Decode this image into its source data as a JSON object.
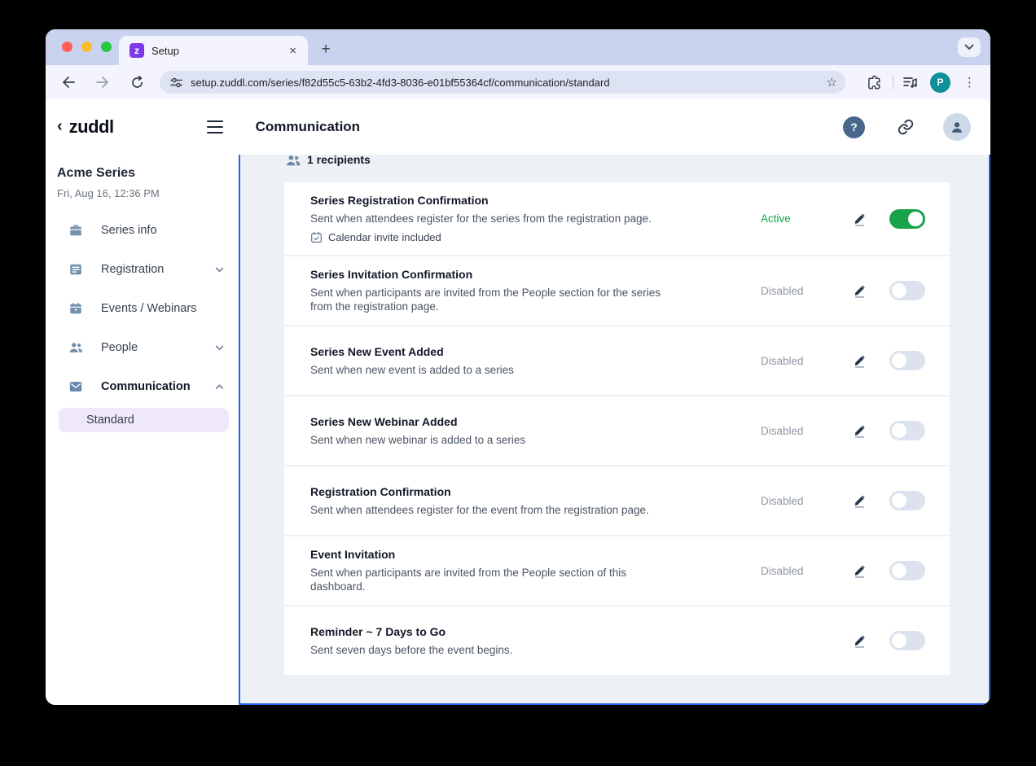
{
  "browser": {
    "tab_title": "Setup",
    "tab_favicon_letter": "z",
    "url": "setup.zuddl.com/series/f82d55c5-63b2-4fd3-8036-e01bf55364cf/communication/standard",
    "profile_initial": "P"
  },
  "app_header": {
    "back_chevron": "‹",
    "logo": "zuddl",
    "title": "Communication",
    "help_label": "?"
  },
  "sidebar": {
    "series_name": "Acme Series",
    "series_datetime": "Fri, Aug 16, 12:36 PM",
    "items": [
      {
        "label": "Series info",
        "icon": "briefcase-icon",
        "chevron": ""
      },
      {
        "label": "Registration",
        "icon": "form-icon",
        "chevron": "down"
      },
      {
        "label": "Events / Webinars",
        "icon": "calendar-icon",
        "chevron": ""
      },
      {
        "label": "People",
        "icon": "people-icon",
        "chevron": "down"
      },
      {
        "label": "Communication",
        "icon": "mail-icon",
        "chevron": "up"
      }
    ],
    "sub_item_label": "Standard"
  },
  "main": {
    "recipients_label": "1 recipients",
    "emails": [
      {
        "title": "Series Registration Confirmation",
        "description": "Sent when attendees register for the series from the registration page.",
        "badge": "Calendar invite included",
        "status": "Active",
        "enabled": true
      },
      {
        "title": "Series Invitation Confirmation",
        "description": "Sent when participants are invited from the People section for the series from the registration page.",
        "badge": "",
        "status": "Disabled",
        "enabled": false
      },
      {
        "title": "Series New Event Added",
        "description": "Sent when new event is added to a series",
        "badge": "",
        "status": "Disabled",
        "enabled": false
      },
      {
        "title": "Series New Webinar Added",
        "description": "Sent when new webinar is added to a series",
        "badge": "",
        "status": "Disabled",
        "enabled": false
      },
      {
        "title": "Registration Confirmation",
        "description": "Sent when attendees register for the event from the registration page.",
        "badge": "",
        "status": "Disabled",
        "enabled": false
      },
      {
        "title": "Event Invitation",
        "description": "Sent when participants are invited from the People section of this dashboard.",
        "badge": "",
        "status": "Disabled",
        "enabled": false
      },
      {
        "title": "Reminder ~ 7 Days to Go",
        "description": "Sent seven days before the event begins.",
        "badge": "",
        "status": "",
        "enabled": false
      }
    ]
  },
  "colors": {
    "brand_purple": "#7c3aed",
    "active_green": "#16a34a",
    "focus_outline_blue": "#2563eb",
    "selected_subitem_bg": "#efe8fb",
    "sidebar_icon_blue": "#7490ab"
  }
}
